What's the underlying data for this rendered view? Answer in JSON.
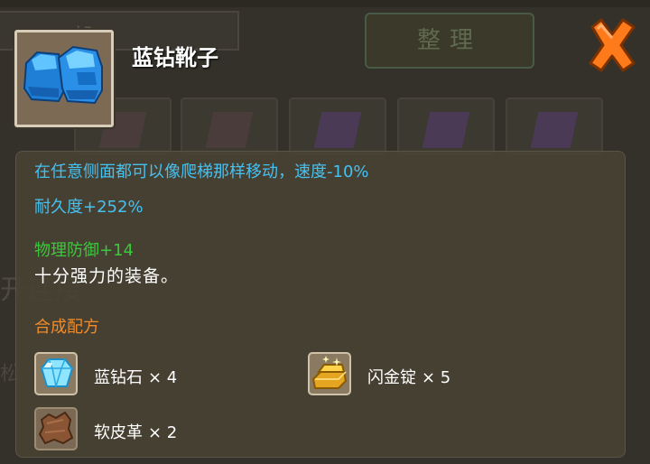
{
  "background": {
    "tab_label": "部",
    "sort_button_label": "整理",
    "left_text": "开连接",
    "left_text2": "松"
  },
  "item": {
    "name": "蓝钻靴子",
    "icon": "blue-diamond-boots-icon"
  },
  "tooltip": {
    "description": "在任意侧面都可以像爬梯那样移动，速度-10%",
    "durability": "耐久度+252%",
    "physical_defense": "物理防御+14",
    "flavor_text": "十分强力的装备。",
    "recipe_title": "合成配方",
    "materials": [
      {
        "name": "蓝钻石",
        "count": "× 4",
        "icon": "blue-diamond-icon"
      },
      {
        "name": "闪金锭",
        "count": "× 5",
        "icon": "gold-ingot-icon"
      },
      {
        "name": "软皮革",
        "count": "× 2",
        "icon": "leather-icon"
      }
    ]
  },
  "colors": {
    "stat_blue": "#45c1f0",
    "stat_green": "#3cc83c",
    "recipe_orange": "#f08c2a",
    "close_orange": "#ff7a1a"
  }
}
